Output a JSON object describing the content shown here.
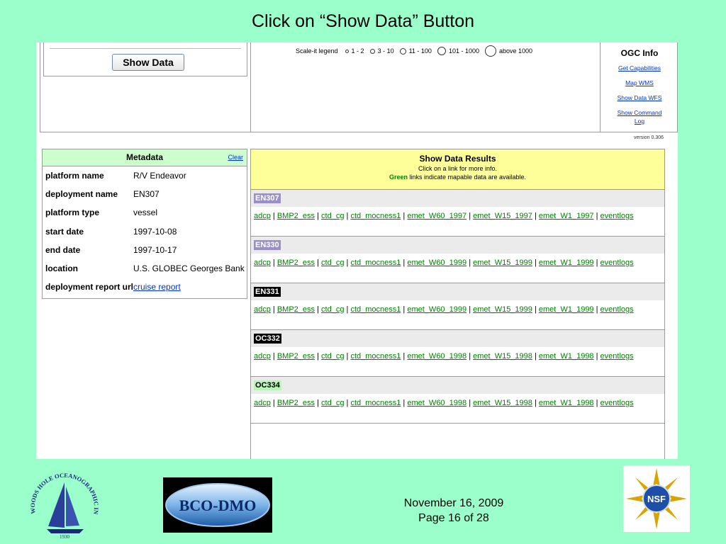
{
  "slide": {
    "title": "Click on “Show Data” Button",
    "date": "November 16, 2009",
    "page": "Page 16 of 28"
  },
  "top": {
    "show_button": "Show Data",
    "scale_legend": {
      "label": "Scale-it legend",
      "items": [
        "1 - 2",
        "3 - 10",
        "11 - 100",
        "101 - 1000",
        "above 1000"
      ]
    },
    "ogc": {
      "title": "OGC Info",
      "links": [
        "Get Capabilities",
        "Map WMS",
        "Show Data WFS",
        "Show Command Log"
      ]
    },
    "version": "version 0.306"
  },
  "metadata": {
    "title": "Metadata",
    "clear": "Clear",
    "rows": [
      {
        "k": "platform name",
        "v": "R/V Endeavor"
      },
      {
        "k": "deployment name",
        "v": "EN307"
      },
      {
        "k": "platform type",
        "v": "vessel"
      },
      {
        "k": "start date",
        "v": "1997-10-08"
      },
      {
        "k": "end date",
        "v": "1997-10-17"
      },
      {
        "k": "location",
        "v": "U.S. GLOBEC Georges Bank"
      },
      {
        "k": "deployment report url",
        "v": "cruise report"
      }
    ]
  },
  "results": {
    "title": "Show Data Results",
    "sub1": "Click on a link for more info.",
    "sub2_green": "Green",
    "sub2_rest": " links indicate mapable data are available.",
    "cruises": [
      {
        "id": "EN307",
        "badge_bg": "#9b8fc9",
        "badge_fg": "#ffffff",
        "links": [
          "adcp",
          "BMP2_ess",
          "ctd_cg",
          "ctd_mocness1",
          "emet_W60_1997",
          "emet_W15_1997",
          "emet_W1_1997",
          "eventlogs"
        ]
      },
      {
        "id": "EN330",
        "badge_bg": "#9b8fc9",
        "badge_fg": "#ffffff",
        "links": [
          "adcp",
          "BMP2_ess",
          "ctd_cg",
          "ctd_mocness1",
          "emet_W60_1999",
          "emet_W15_1999",
          "emet_W1_1999",
          "eventlogs"
        ]
      },
      {
        "id": "EN331",
        "badge_bg": "#000000",
        "badge_fg": "#ffffff",
        "links": [
          "adcp",
          "BMP2_ess",
          "ctd_cg",
          "ctd_mocness1",
          "emet_W60_1999",
          "emet_W15_1999",
          "emet_W1_1999",
          "eventlogs"
        ]
      },
      {
        "id": "OC332",
        "badge_bg": "#000000",
        "badge_fg": "#ffffff",
        "links": [
          "adcp",
          "BMP2_ess",
          "ctd_cg",
          "ctd_mocness1",
          "emet_W60_1998",
          "emet_W15_1998",
          "emet_W1_1998",
          "eventlogs"
        ]
      },
      {
        "id": "OC334",
        "badge_bg": "#b8f5b8",
        "badge_fg": "#000000",
        "links": [
          "adcp",
          "BMP2_ess",
          "ctd_cg",
          "ctd_mocness1",
          "emet_W60_1998",
          "emet_W15_1998",
          "emet_W1_1998",
          "eventlogs"
        ]
      }
    ]
  },
  "logos": {
    "whoi_text": "WOODS HOLE OCEANOGRAPHIC INSTITUTION",
    "whoi_year": "1930",
    "bco_text": "BCO-DMO",
    "nsf_text": "NSF"
  }
}
